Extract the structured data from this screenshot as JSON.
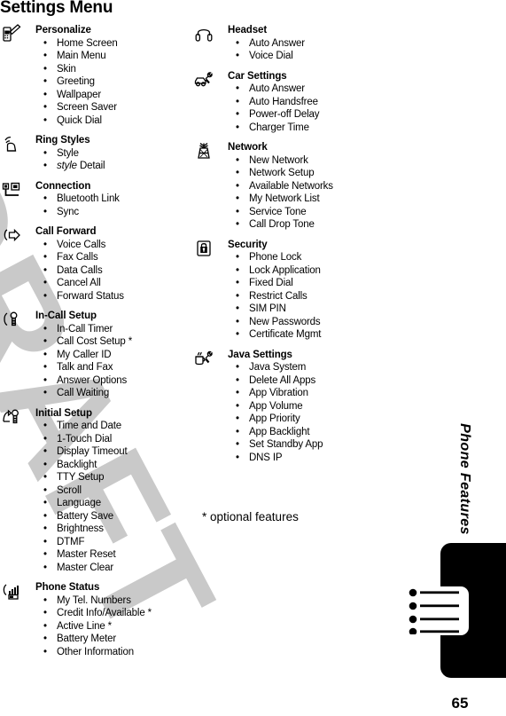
{
  "page": {
    "title": "Settings Menu",
    "number": "65",
    "side_label": "Phone Features",
    "watermark": "DRAFT",
    "footnote": "* optional features",
    "watermark_color": "#c9c9c9",
    "tab_color": "#000000"
  },
  "left_column": [
    {
      "icon": "phone-pencil-icon",
      "title": "Personalize",
      "items": [
        "Home Screen",
        "Main Menu",
        "Skin",
        "Greeting",
        "Wallpaper",
        "Screen Saver",
        "Quick Dial"
      ]
    },
    {
      "icon": "ring-bell-icon",
      "title": "Ring Styles",
      "items": [
        "Style",
        "style Detail"
      ],
      "italic_first_word": [
        1
      ]
    },
    {
      "icon": "connection-icon",
      "title": "Connection",
      "items": [
        "Bluetooth Link",
        "Sync"
      ]
    },
    {
      "icon": "call-forward-icon",
      "title": "Call Forward",
      "items": [
        "Voice Calls",
        "Fax Calls",
        "Data Calls",
        "Cancel All",
        "Forward Status"
      ]
    },
    {
      "icon": "in-call-setup-icon",
      "title": "In-Call Setup",
      "items": [
        "In-Call Timer",
        "Call Cost Setup *",
        "My Caller ID",
        "Talk and Fax",
        "Answer Options",
        "Call Waiting"
      ]
    },
    {
      "icon": "initial-setup-icon",
      "title": "Initial Setup",
      "items": [
        "Time and Date",
        "1-Touch Dial",
        "Display Timeout",
        "Backlight",
        "TTY Setup",
        "Scroll",
        "Language",
        "Battery Save",
        "Brightness",
        "DTMF",
        "Master Reset",
        "Master Clear"
      ]
    },
    {
      "icon": "phone-status-icon",
      "title": "Phone Status",
      "items": [
        "My Tel. Numbers",
        "Credit Info/Available *",
        "Active Line *",
        "Battery Meter",
        "Other Information"
      ]
    }
  ],
  "right_column": [
    {
      "icon": "headset-icon",
      "title": "Headset",
      "items": [
        "Auto Answer",
        "Voice Dial"
      ]
    },
    {
      "icon": "car-settings-icon",
      "title": "Car Settings",
      "items": [
        "Auto Answer",
        "Auto Handsfree",
        "Power-off Delay",
        "Charger Time"
      ]
    },
    {
      "icon": "network-tower-icon",
      "title": "Network",
      "items": [
        "New Network",
        "Network Setup",
        "Available Networks",
        "My Network List",
        "Service Tone",
        "Call Drop Tone"
      ]
    },
    {
      "icon": "padlock-icon",
      "title": "Security",
      "items": [
        "Phone Lock",
        "Lock Application",
        "Fixed Dial",
        "Restrict Calls",
        "SIM PIN",
        "New Passwords",
        "Certificate Mgmt"
      ]
    },
    {
      "icon": "java-settings-icon",
      "title": "Java Settings",
      "items": [
        "Java System",
        "Delete All Apps",
        "App Vibration",
        "App Volume",
        "App Priority",
        "App Backlight",
        "Set Standby App",
        "DNS IP"
      ]
    }
  ]
}
